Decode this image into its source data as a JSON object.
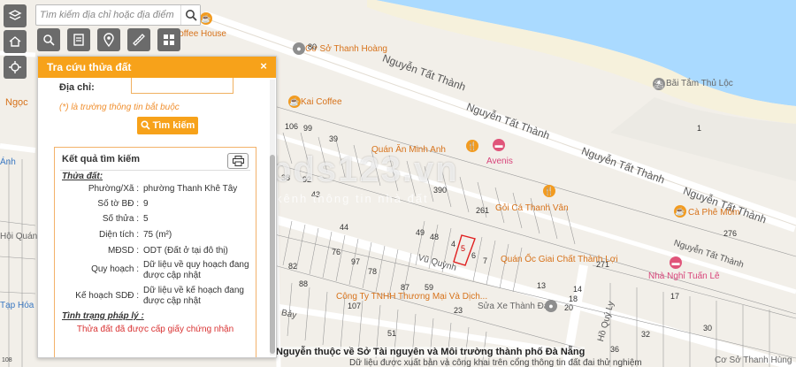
{
  "search": {
    "placeholder": "Tìm kiếm địa chỉ hoặc địa điểm"
  },
  "panel": {
    "title": "Tra cứu thửa đất",
    "close_label": "×",
    "address_label": "Địa chỉ:",
    "address_value": "",
    "required_note": "(*) là trường thông tin bắt buộc",
    "lookup_button": "Tìm kiếm",
    "result": {
      "title": "Kết quả tìm kiếm",
      "parcel_section": "Thửa đất:",
      "rows": [
        {
          "label": "Phường/Xã :",
          "value": "phường Thanh Khê Tây"
        },
        {
          "label": "Số tờ BĐ :",
          "value": "9"
        },
        {
          "label": "Số thửa :",
          "value": "5"
        },
        {
          "label": "Diện tích :",
          "value": "75 (m²)"
        },
        {
          "label": "MĐSD :",
          "value": "ODT (Đất ở tại đô thị)"
        },
        {
          "label": "Quy hoạch :",
          "value": "Dữ liệu về quy hoạch đang được cập nhật"
        },
        {
          "label": "Kế hoạch SDĐ :",
          "value": "Dữ liệu về kế hoạch đang được cập nhật"
        }
      ],
      "legal_section": "Tình trạng pháp lý :",
      "legal_status": "Thửa đất đã được cấp giấy chứng nhận"
    }
  },
  "map": {
    "roads": [
      "Nguyễn Tất Thành",
      "Nguyễn Tất Thành",
      "Nguyễn Tất Thành",
      "Nguyễn Tất Thành",
      "Nguyễn Tất Thành",
      "Vũ Quỳnh",
      "Hồ Quý Ly",
      "Bảy"
    ],
    "pois": [
      "Cơ Sở Thanh Hoàng",
      "Kai Coffee",
      "Quán Ăn Minh Anh",
      "Avenis",
      "Gỏi Cá Thanh Vân",
      "Cà Phê Mõm",
      "Nhà Nghỉ Tuấn Lê",
      "Bãi Tắm Thủ Lộc",
      "Coffee House",
      "Quán Ốc Giai Chất Thành Lợi",
      "Công Ty TNHH Thương Mại Và Dịch...",
      "Sửa Xe Thành Đạt",
      "Cơ Sở Thanh Hùng",
      "Ngọc",
      "Ánh",
      "Hội Quán",
      "Tạp Hóa"
    ],
    "watermark": "bds123.vn",
    "watermark_sub": "kênh thông tin nhà đất",
    "parcel_numbers": [
      "80",
      "1",
      "99",
      "39",
      "106",
      "38",
      "92",
      "43",
      "390",
      "261",
      "44",
      "49",
      "48",
      "4",
      "5",
      "6",
      "7",
      "271",
      "97",
      "76",
      "78",
      "82",
      "88",
      "107",
      "23",
      "20",
      "13",
      "14",
      "18",
      "276",
      "59",
      "87",
      "51",
      "17",
      "32",
      "36",
      "30"
    ],
    "footer_line1": "Nguyễn thuộc về Sở Tài nguyên và Môi trường thành phố Đà Nẵng",
    "footer_line2": "Dữ liệu được xuất bản và công khai trên cổng thông tin đất đai thử nghiệm",
    "scale": "108"
  },
  "colors": {
    "accent": "#f7a21a",
    "water": "#aadaff",
    "selected_parcel": "#e02020",
    "required": "#f09030",
    "legal_ok": "#d93333"
  }
}
